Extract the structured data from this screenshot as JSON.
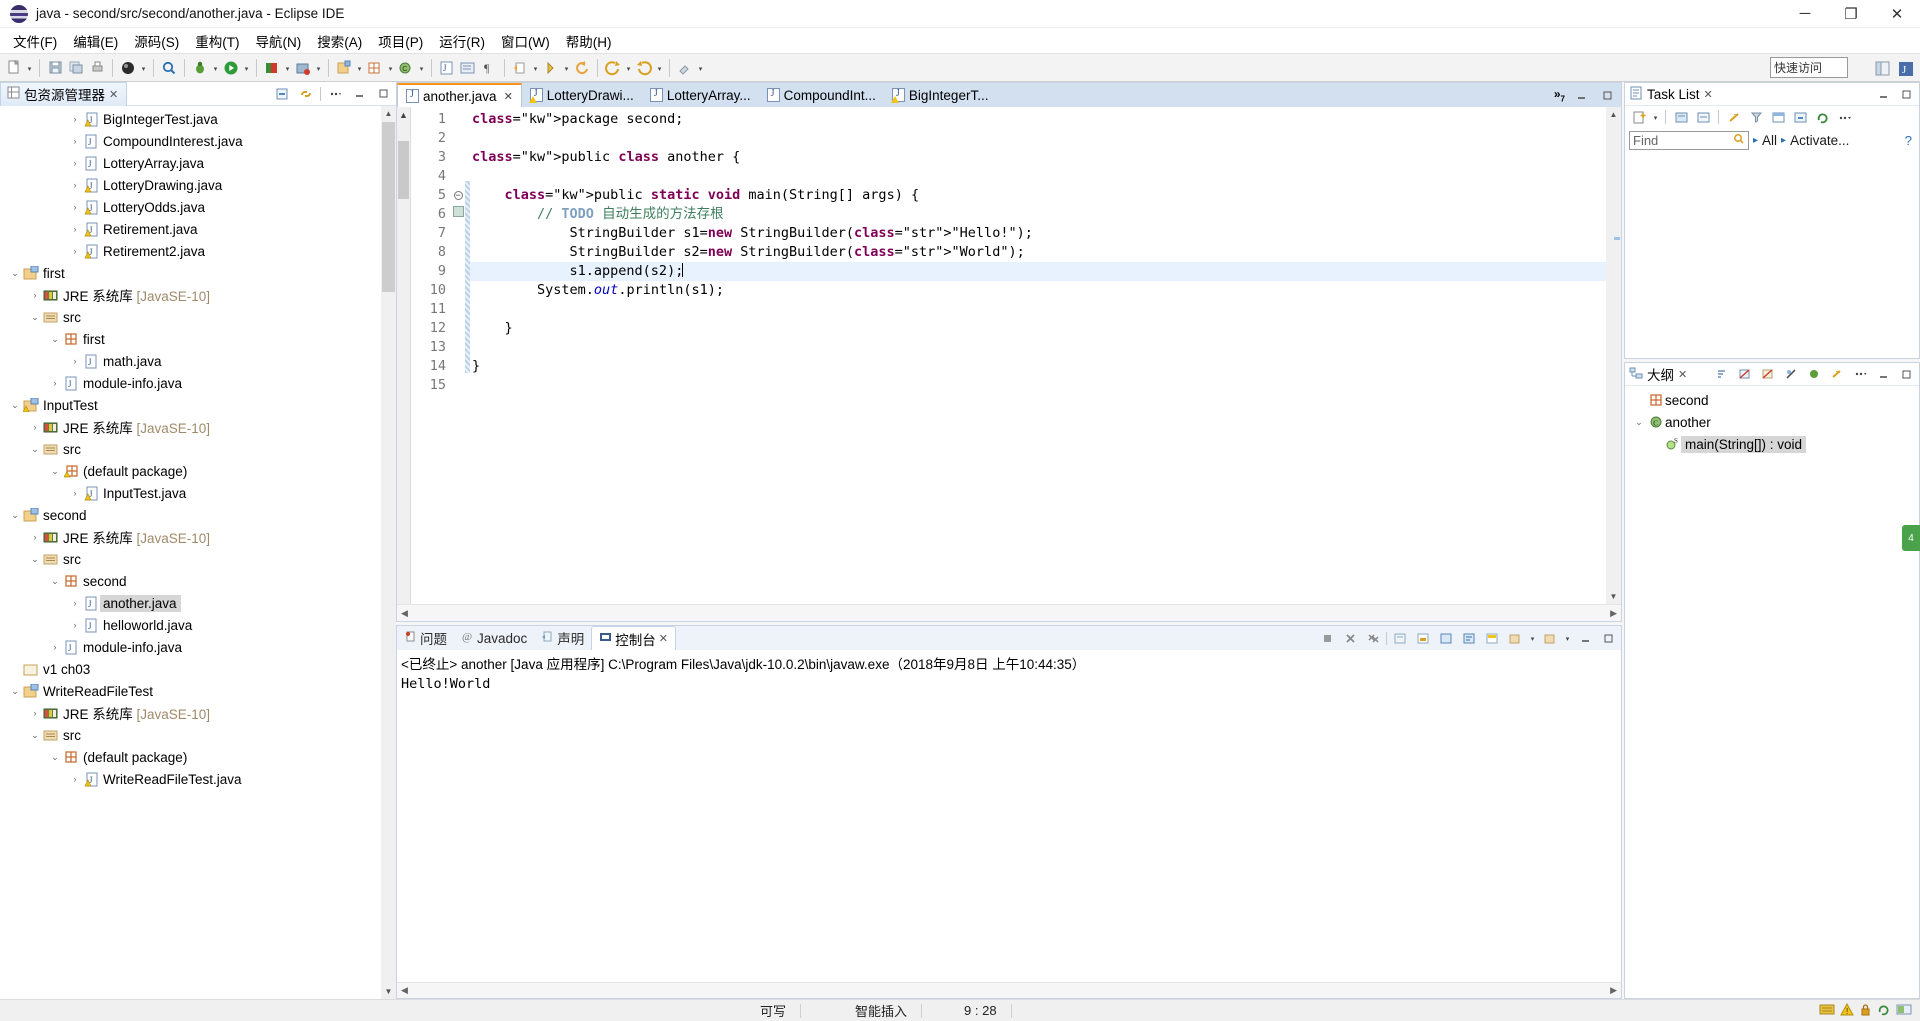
{
  "window": {
    "title": "java - second/src/second/another.java - Eclipse IDE",
    "minimize": "─",
    "maximize": "❐",
    "close": "✕"
  },
  "menubar": {
    "items": [
      {
        "label": "文件(F)"
      },
      {
        "label": "编辑(E)"
      },
      {
        "label": "源码(S)"
      },
      {
        "label": "重构(T)"
      },
      {
        "label": "导航(N)"
      },
      {
        "label": "搜索(A)"
      },
      {
        "label": "项目(P)"
      },
      {
        "label": "运行(R)"
      },
      {
        "label": "窗口(W)"
      },
      {
        "label": "帮助(H)"
      }
    ]
  },
  "toolbar": {
    "quick_access": "快速访问",
    "icons": [
      "new-icon",
      "save-icon",
      "save-all-icon",
      "print-icon",
      "quick-fix-icon",
      "debug-icon",
      "run-icon",
      "run-coverage-icon",
      "external-tools-icon",
      "new-java-project-icon",
      "new-java-package-icon",
      "new-class-icon",
      "open-type-icon",
      "search-icon",
      "next-annotation-icon",
      "prev-annotation-icon",
      "last-edit-location-icon",
      "back-icon",
      "forward-icon",
      "pin-icon"
    ]
  },
  "package_explorer": {
    "title": "包资源管理器",
    "close_label": "✕",
    "tools": [
      "collapse-all-icon",
      "link-with-editor-icon",
      "view-menu-icon",
      "minimize-icon",
      "maximize-icon"
    ],
    "tree": [
      {
        "label": "BigIntegerTest.java",
        "indent": 3,
        "twisty": "›",
        "icon": "java-file-warn-icon"
      },
      {
        "label": "CompoundInterest.java",
        "indent": 3,
        "twisty": "›",
        "icon": "java-file-icon"
      },
      {
        "label": "LotteryArray.java",
        "indent": 3,
        "twisty": "›",
        "icon": "java-file-icon"
      },
      {
        "label": "LotteryDrawing.java",
        "indent": 3,
        "twisty": "›",
        "icon": "java-file-warn-icon"
      },
      {
        "label": "LotteryOdds.java",
        "indent": 3,
        "twisty": "›",
        "icon": "java-file-warn-icon"
      },
      {
        "label": "Retirement.java",
        "indent": 3,
        "twisty": "›",
        "icon": "java-file-warn-icon"
      },
      {
        "label": "Retirement2.java",
        "indent": 3,
        "twisty": "›",
        "icon": "java-file-warn-icon"
      },
      {
        "label": "first",
        "indent": 0,
        "twisty": "⌄",
        "icon": "project-icon"
      },
      {
        "label": "JRE 系统库 [JavaSE-10]",
        "indent": 1,
        "twisty": "›",
        "icon": "jre-library-icon",
        "dim_suffix": "[JavaSE-10]"
      },
      {
        "label": "src",
        "indent": 1,
        "twisty": "⌄",
        "icon": "source-folder-icon"
      },
      {
        "label": "first",
        "indent": 2,
        "twisty": "⌄",
        "icon": "package-icon"
      },
      {
        "label": "math.java",
        "indent": 3,
        "twisty": "›",
        "icon": "java-file-icon"
      },
      {
        "label": "module-info.java",
        "indent": 2,
        "twisty": "›",
        "icon": "java-file-icon"
      },
      {
        "label": "InputTest",
        "indent": 0,
        "twisty": "⌄",
        "icon": "project-warn-icon"
      },
      {
        "label": "JRE 系统库 [JavaSE-10]",
        "indent": 1,
        "twisty": "›",
        "icon": "jre-library-icon",
        "dim_suffix": "[JavaSE-10]"
      },
      {
        "label": "src",
        "indent": 1,
        "twisty": "⌄",
        "icon": "source-folder-icon"
      },
      {
        "label": "(default package)",
        "indent": 2,
        "twisty": "⌄",
        "icon": "package-warn-icon"
      },
      {
        "label": "InputTest.java",
        "indent": 3,
        "twisty": "›",
        "icon": "java-file-warn-icon"
      },
      {
        "label": "second",
        "indent": 0,
        "twisty": "⌄",
        "icon": "project-icon"
      },
      {
        "label": "JRE 系统库 [JavaSE-10]",
        "indent": 1,
        "twisty": "›",
        "icon": "jre-library-icon",
        "dim_suffix": "[JavaSE-10]"
      },
      {
        "label": "src",
        "indent": 1,
        "twisty": "⌄",
        "icon": "source-folder-icon"
      },
      {
        "label": "second",
        "indent": 2,
        "twisty": "⌄",
        "icon": "package-icon"
      },
      {
        "label": "another.java",
        "indent": 3,
        "twisty": "›",
        "icon": "java-file-icon",
        "selected": true
      },
      {
        "label": "helloworld.java",
        "indent": 3,
        "twisty": "›",
        "icon": "java-file-icon"
      },
      {
        "label": "module-info.java",
        "indent": 2,
        "twisty": "›",
        "icon": "java-file-icon"
      },
      {
        "label": "v1 ch03",
        "indent": 0,
        "twisty": "",
        "icon": "closed-project-icon"
      },
      {
        "label": "WriteReadFileTest",
        "indent": 0,
        "twisty": "⌄",
        "icon": "project-icon"
      },
      {
        "label": "JRE 系统库 [JavaSE-10]",
        "indent": 1,
        "twisty": "›",
        "icon": "jre-library-icon",
        "dim_suffix": "[JavaSE-10]"
      },
      {
        "label": "src",
        "indent": 1,
        "twisty": "⌄",
        "icon": "source-folder-icon"
      },
      {
        "label": "(default package)",
        "indent": 2,
        "twisty": "⌄",
        "icon": "package-icon"
      },
      {
        "label": "WriteReadFileTest.java",
        "indent": 3,
        "twisty": "›",
        "icon": "java-file-warn-icon"
      }
    ]
  },
  "editor": {
    "tabs": [
      {
        "label": "another.java",
        "active": true,
        "icon": "java-file-icon",
        "close": "✕"
      },
      {
        "label": "LotteryDrawi...",
        "active": false,
        "icon": "java-file-warn-icon"
      },
      {
        "label": "LotteryArray...",
        "active": false,
        "icon": "java-file-icon"
      },
      {
        "label": "CompoundInt...",
        "active": false,
        "icon": "java-file-icon"
      },
      {
        "label": "BigIntegerT...",
        "active": false,
        "icon": "java-file-warn-icon"
      }
    ],
    "overflow_label": "»",
    "overflow_count": "7",
    "line_numbers": [
      "1",
      "2",
      "3",
      "4",
      "5",
      "6",
      "7",
      "8",
      "9",
      "10",
      "11",
      "12",
      "13",
      "14",
      "15"
    ],
    "code_lines": [
      {
        "n": 1,
        "text": "package second;"
      },
      {
        "n": 2,
        "text": ""
      },
      {
        "n": 3,
        "text": "public class another {"
      },
      {
        "n": 4,
        "text": ""
      },
      {
        "n": 5,
        "text": "    public static void main(String[] args) {"
      },
      {
        "n": 6,
        "text": "        // TODO 自动生成的方法存根"
      },
      {
        "n": 7,
        "text": "            StringBuilder s1=new StringBuilder(\"Hello!\");"
      },
      {
        "n": 8,
        "text": "            StringBuilder s2=new StringBuilder(\"World\");"
      },
      {
        "n": 9,
        "text": "            s1.append(s2);",
        "highlight": true
      },
      {
        "n": 10,
        "text": "        System.out.println(s1);"
      },
      {
        "n": 11,
        "text": ""
      },
      {
        "n": 12,
        "text": "    }"
      },
      {
        "n": 13,
        "text": ""
      },
      {
        "n": 14,
        "text": "}"
      },
      {
        "n": 15,
        "text": ""
      }
    ]
  },
  "console": {
    "tabs": [
      {
        "label": "问题",
        "active": false,
        "icon": "problems-icon"
      },
      {
        "label": "Javadoc",
        "active": false,
        "icon": "javadoc-icon"
      },
      {
        "label": "声明",
        "active": false,
        "icon": "declaration-icon"
      },
      {
        "label": "控制台",
        "active": true,
        "icon": "console-icon",
        "close": "✕"
      }
    ],
    "header_line": "<已终止> another [Java 应用程序] C:\\Program Files\\Java\\jdk-10.0.2\\bin\\javaw.exe（2018年9月8日 上午10:44:35）",
    "output": "Hello!World",
    "tools": [
      "terminate-icon",
      "remove-launch-icon",
      "remove-all-icon",
      "clear-icon",
      "scroll-lock-icon",
      "pin-icon",
      "word-wrap-icon",
      "display-selected-console-icon",
      "open-console-icon",
      "view-menu-icon",
      "minimize-icon",
      "maximize-icon"
    ]
  },
  "task_list": {
    "title": "Task List",
    "close_label": "✕",
    "find_placeholder": "Find",
    "all_label": "All",
    "activate_label": "Activate...",
    "help_label": "?",
    "tools": [
      "new-task-icon",
      "categorize-icon",
      "focus-icon",
      "schedule-icon",
      "filter-icon",
      "collapse-icon",
      "synchronize-icon",
      "view-menu-icon",
      "minimize-icon",
      "maximize-icon"
    ]
  },
  "outline": {
    "title": "大纲",
    "close_label": "✕",
    "tools": [
      "sort-icon",
      "hide-fields-icon",
      "hide-static-icon",
      "hide-nonpublic-icon",
      "hide-local-types-icon",
      "focus-icon",
      "link-icon",
      "view-menu-icon",
      "minimize-icon",
      "maximize-icon"
    ],
    "items": [
      {
        "label": "second",
        "indent": 0,
        "twisty": "",
        "icon": "package-icon"
      },
      {
        "label": "another",
        "indent": 0,
        "twisty": "⌄",
        "icon": "class-icon"
      },
      {
        "label": "main(String[]) : void",
        "indent": 1,
        "twisty": "",
        "icon": "method-static-icon",
        "selected": true
      }
    ]
  },
  "status_bar": {
    "writable": "可写",
    "insert_mode": "智能插入",
    "position": "9 : 28",
    "icons": [
      "keyboard-icon",
      "warning-icon",
      "lock-icon",
      "sync-icon",
      "heap-icon"
    ]
  },
  "colors": {
    "tab_active_border": "#f7941d",
    "tab_strip": "#d3e0f0",
    "keyword": "#7f0055",
    "string": "#2a00ff",
    "comment": "#3f7f5f",
    "todo": "#7f9fbf",
    "selection": "#e8f2fe",
    "tree_selection": "#d6d6d6"
  }
}
